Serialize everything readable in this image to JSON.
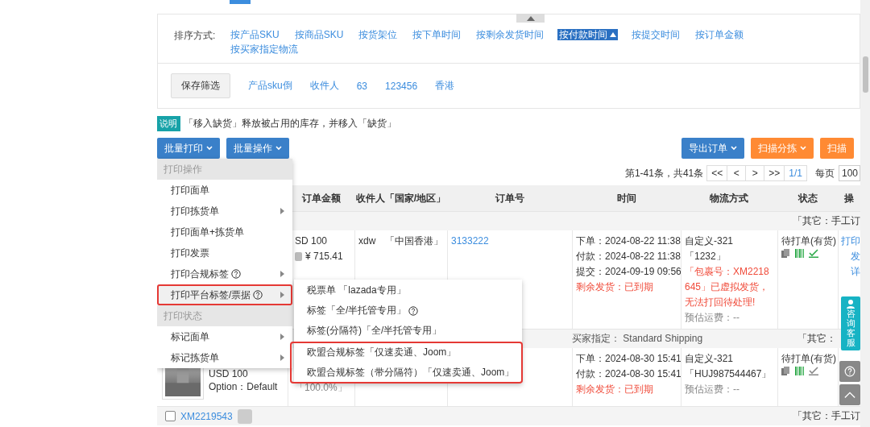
{
  "sort": {
    "label": "排序方式:",
    "options": [
      {
        "label": "按产品SKU",
        "selected": false
      },
      {
        "label": "按商品SKU",
        "selected": false
      },
      {
        "label": "按货架位",
        "selected": false
      },
      {
        "label": "按下单时间",
        "selected": false
      },
      {
        "label": "按剩余发货时间",
        "selected": false
      },
      {
        "label": "按付款时间",
        "selected": true
      },
      {
        "label": "按提交时间",
        "selected": false
      },
      {
        "label": "按订单金额",
        "selected": false
      },
      {
        "label": "按买家指定物流",
        "selected": false
      }
    ]
  },
  "saved_filters": {
    "button": "保存筛选",
    "items": [
      "产品sku倒",
      "收件人",
      "63",
      "123456",
      "香港"
    ]
  },
  "note": {
    "badge": "说明",
    "text": "「移入缺货」释放被占用的库存，并移入「缺货」"
  },
  "actions_left": [
    {
      "label": "批量打印",
      "kind": "primary"
    },
    {
      "label": "批量操作",
      "kind": "primary"
    }
  ],
  "actions_right": [
    {
      "label": "导出订单",
      "kind": "primary"
    },
    {
      "label": "扫描分拣",
      "kind": "warning"
    },
    {
      "label": "扫描",
      "kind": "warning"
    }
  ],
  "pagination": {
    "summary": "第1-41条，共41条",
    "buttons": [
      "<<",
      "<",
      ">",
      ">>"
    ],
    "page": "1/1",
    "per_page_label": "每页",
    "per_page": "100"
  },
  "table": {
    "columns": [
      "订单金额",
      "收件人「国家/地区」",
      "订单号",
      "时间",
      "物流方式",
      "状态",
      "操"
    ],
    "groups": [
      {
        "source": "「其它：手工订",
        "order": {
          "amount": "SD 100",
          "cny": "¥ 715.41",
          "recipient": "xdw　「中国香港」",
          "order_no": "3133222",
          "times": [
            {
              "text": "下单：2024-08-22 11:38",
              "alert": false
            },
            {
              "text": "付款：2024-08-22 11:38",
              "alert": false
            },
            {
              "text": "提交：2024-09-19 09:56",
              "alert": false
            },
            {
              "text": "剩余发货：已到期",
              "alert": true
            }
          ],
          "logistics": [
            {
              "text": "自定义-321",
              "kind": "plain"
            },
            {
              "text": "「1232」",
              "kind": "plain"
            },
            {
              "text": "「包裹号：XM2218645」已虚拟发货，无法打回待处理!",
              "kind": "alert"
            },
            {
              "text": "预估运费：--",
              "kind": "muted"
            }
          ],
          "status": "待打单(有货)",
          "verified": true,
          "ops": [
            "打印",
            "发",
            "详"
          ]
        }
      },
      {
        "header_note": "买家指定：  Standard Shipping",
        "source": "「其它：",
        "order": {
          "product_price": "USD 100",
          "product_option": "Option：Default",
          "share": "「100.0%」",
          "times": [
            {
              "text": "下单：2024-08-30 15:41",
              "alert": false
            },
            {
              "text": "付款：2024-08-30 15:41",
              "alert": false
            },
            {
              "text": "剩余发货：已到期",
              "alert": true
            }
          ],
          "logistics": [
            {
              "text": "自定义-321",
              "kind": "plain"
            },
            {
              "text": "「HUJ987544467」",
              "kind": "plain"
            },
            {
              "text": "预估运费：--",
              "kind": "muted"
            }
          ],
          "status": "待打单(有货)",
          "verified": false
        }
      },
      {
        "source": "「其它：手工订",
        "order_link": "XM2219543",
        "checked": false
      }
    ]
  },
  "menu": {
    "sections": [
      {
        "title": "打印操作",
        "items": [
          {
            "label": "打印面单",
            "submenu": false,
            "help": false,
            "selected": false
          },
          {
            "label": "打印拣货单",
            "submenu": true,
            "help": false,
            "selected": false
          },
          {
            "label": "打印面单+拣货单",
            "submenu": false,
            "help": false,
            "selected": false
          },
          {
            "label": "打印发票",
            "submenu": false,
            "help": false,
            "selected": false
          },
          {
            "label": "打印合规标签",
            "submenu": true,
            "help": true,
            "selected": false
          },
          {
            "label": "打印平台标签/票据",
            "submenu": true,
            "help": true,
            "selected": true,
            "outlined": true
          }
        ]
      },
      {
        "title": "打印状态",
        "items": [
          {
            "label": "标记面单",
            "submenu": true,
            "help": false,
            "selected": false
          },
          {
            "label": "标记拣货单",
            "submenu": true,
            "help": false,
            "selected": false
          }
        ]
      }
    ]
  },
  "submenu": {
    "groups": [
      {
        "outlined": false,
        "items": [
          {
            "label": "税票单 「lazada专用」",
            "help": false
          },
          {
            "label": "标签「全/半托管专用」",
            "help": true
          },
          {
            "label": "标签(分隔符)「全/半托管专用」",
            "help": false
          }
        ]
      },
      {
        "outlined": true,
        "items": [
          {
            "label": "欧盟合规标签「仅速卖通、Joom」",
            "help": false
          },
          {
            "label": "欧盟合规标签（带分隔符）「仅速卖通、Joom」",
            "help": false
          }
        ]
      }
    ]
  },
  "float": {
    "service": "咨询客服"
  }
}
